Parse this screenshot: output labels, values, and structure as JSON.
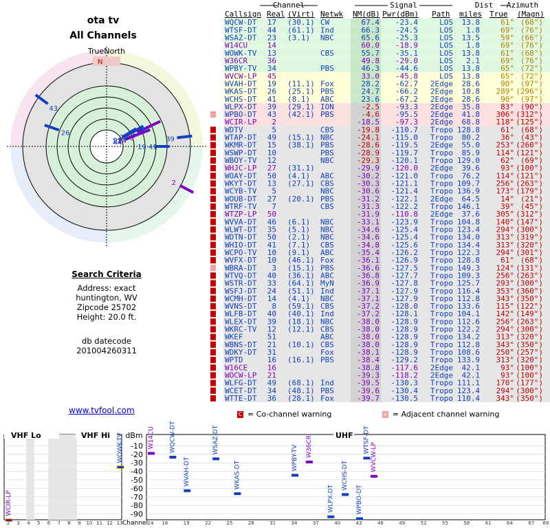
{
  "header": {
    "line1": "ota tv",
    "line2": "All Channels"
  },
  "polar": {
    "north_label": "TrueNorth",
    "n_label": "N"
  },
  "criteria": {
    "title": "Search Criteria",
    "lines": [
      "Address: exact",
      "huntington, WV",
      "Zipcode 25702",
      "Height: 20.0 ft."
    ],
    "db_lines": [
      "db datecode",
      "201004260311"
    ]
  },
  "link": "www.tvfool.com",
  "table_headers": {
    "group_channel": "Channel",
    "group_signal": "Signal",
    "group_dist": "Dist",
    "group_az": "Azimuth",
    "callsign": "Callsign",
    "real": "Real",
    "virt": "(Virt)",
    "netwk": "Netwk",
    "nm": "NM(dB)",
    "pwr": "Pwr(dBm)",
    "path": "Path",
    "miles": "miles",
    "true": "True",
    "magn": "(Magn)"
  },
  "colors": {
    "green": "#008000",
    "blue": "#1040c0",
    "purple": "#8000c0",
    "red": "#c00000",
    "bg_green": "#e0f8e0",
    "bg_yellow": "#ffffd8",
    "bg_red": "#fbe0e0",
    "bg_gray": "#e6e6e6",
    "bg_nm": "#d2d2d2"
  },
  "rows": [
    [
      "WQCW-DT",
      "17",
      "(30.1)",
      "CW",
      "67.4",
      "-23.4",
      "LOS",
      "13.8",
      "61°",
      "(68°)",
      "g",
      ""
    ],
    [
      "WTSF-DT",
      "44",
      "(61.1)",
      "Ind",
      "66.3",
      "-24.5",
      "LOS",
      "1.8",
      "69°",
      "(76°)",
      "g",
      ""
    ],
    [
      "WSAZ-DT",
      "23",
      "(3.1)",
      "NBC",
      "65.6",
      "-25.3",
      "LOS",
      "13.5",
      "59°",
      "(66°)",
      "g",
      ""
    ],
    [
      "W14CU",
      "14",
      "",
      "",
      "60.0",
      "-18.9",
      "LOS",
      "1.8",
      "69°",
      "(76°)",
      "g",
      ""
    ],
    [
      "WOWK-TV",
      "13",
      "",
      "CBS",
      "55.7",
      "-35.1",
      "LOS",
      "13.8",
      "61°",
      "(68°)",
      "g",
      ""
    ],
    [
      "W36CR",
      "36",
      "",
      "",
      "49.8",
      "-29.0",
      "LOS",
      "2.1",
      "69°",
      "(76°)",
      "g",
      ""
    ],
    [
      "WPBY-TV",
      "34",
      "",
      "PBS",
      "46.3",
      "-44.6",
      "LOS",
      "13.8",
      "65°",
      "(72°)",
      "g",
      ""
    ],
    [
      "WVCW-LP",
      "45",
      "",
      "",
      "33.0",
      "-45.8",
      "LOS",
      "13.8",
      "65°",
      "(72°)",
      "y",
      ""
    ],
    [
      "WVAH-DT",
      "19",
      "(11.1)",
      "Fox",
      "28.2",
      "-62.7",
      "2Edge",
      "28.6",
      "90°",
      "(97°)",
      "y",
      ""
    ],
    [
      "WKAS-DT",
      "26",
      "(25.1)",
      "PBS",
      "24.7",
      "-66.2",
      "2Edge",
      "10.8",
      "289°",
      "(296°)",
      "y",
      ""
    ],
    [
      "WCHS-DT",
      "41",
      "(8.1)",
      "ABC",
      "23.6",
      "-67.2",
      "2Edge",
      "28.6",
      "90°",
      "(97°)",
      "y",
      ""
    ],
    [
      "WLPX-DT",
      "39",
      "(29.1)",
      "ION",
      "-2.5",
      "-93.3",
      "2Edge",
      "35.8",
      "83°",
      "(90°)",
      "r",
      ""
    ],
    [
      "WPBO-DT",
      "43",
      "(42.1)",
      "PBS",
      "-4.6",
      "-95.5",
      "2Edge",
      "41.8",
      "306°",
      "(312°)",
      "r",
      "a"
    ],
    [
      "WCIR-LP",
      "2",
      "",
      "",
      "-18.5",
      "-97.3",
      "2Edge",
      "68.8",
      "118°",
      "(125°)",
      "r",
      ""
    ],
    [
      "WDTV",
      "5",
      "",
      "CBS",
      "-19.8",
      "-110.7",
      "Tropo",
      "128.8",
      "61°",
      "(68°)",
      "n",
      "c"
    ],
    [
      "WTAP-DT",
      "49",
      "(15.1)",
      "NBC",
      "-24.1",
      "-115.0",
      "Tropo",
      "80.2",
      "36°",
      "(43°)",
      "n",
      "c"
    ],
    [
      "WKMR-DT",
      "15",
      "(38.1)",
      "PBS",
      "-28.6",
      "-119.5",
      "2Edge",
      "55.0",
      "253°",
      "(260°)",
      "n",
      "c"
    ],
    [
      "WSWP-DT",
      "10",
      "",
      "PBS",
      "-28.9",
      "-119.7",
      "Tropo",
      "85.9",
      "114°",
      "(121°)",
      "n",
      "c"
    ],
    [
      "WBOY-TV",
      "12",
      "",
      "NBC",
      "-29.3",
      "-120.1",
      "Tropo",
      "129.0",
      "62°",
      "(69°)",
      "n",
      "c"
    ],
    [
      "WHJC-LP",
      "27",
      "(31.1)",
      "",
      "-29.9",
      "-120.0",
      "2Edge",
      "39.6",
      "93°",
      "(100°)",
      "n",
      "c"
    ],
    [
      "WOAY-DT",
      "50",
      "(4.1)",
      "ABC",
      "-30.2",
      "-121.0",
      "Tropo",
      "76.2",
      "114°",
      "(121°)",
      "n",
      "c"
    ],
    [
      "WKYT-DT",
      "13",
      "(27.1)",
      "CBS",
      "-30.3",
      "-121.1",
      "Tropo",
      "109.7",
      "256°",
      "(263°)",
      "n",
      "c"
    ],
    [
      "WCYB-TV",
      "5",
      "",
      "NBC",
      "-30.6",
      "-121.4",
      "Tropo",
      "136.9",
      "173°",
      "(179°)",
      "n",
      "c"
    ],
    [
      "WOUB-DT",
      "27",
      "(20.1)",
      "PBS",
      "-31.2",
      "-122.1",
      "2Edge",
      "64.5",
      "14°",
      "(21°)",
      "n",
      "c"
    ],
    [
      "WTRF-TV",
      "7",
      "",
      "CBS",
      "-31.3",
      "-122.2",
      "Tropo",
      "146.1",
      "39°",
      "(45°)",
      "n",
      "c"
    ],
    [
      "WTZP-LP",
      "50",
      "",
      "",
      "-31.9",
      "-110.8",
      "2Edge",
      "37.6",
      "305°",
      "(312°)",
      "p",
      "c"
    ],
    [
      "WVVA-DT",
      "46",
      "(6.1)",
      "NBC",
      "-33.1",
      "-123.9",
      "Tropo",
      "104.8",
      "140°",
      "(147°)",
      "n",
      "c"
    ],
    [
      "WLWT-DT",
      "35",
      "(5.1)",
      "NBC",
      "-34.6",
      "-125.4",
      "Tropo",
      "123.4",
      "294°",
      "(300°)",
      "n",
      "c"
    ],
    [
      "WDTN-DT",
      "50",
      "(2.1)",
      "NBC",
      "-34.6",
      "-125.4",
      "Tropo",
      "134.0",
      "313°",
      "(319°)",
      "n",
      "c"
    ],
    [
      "WHIO-DT",
      "41",
      "(7.1)",
      "CBS",
      "-34.8",
      "-125.6",
      "Tropo",
      "134.4",
      "313°",
      "(320°)",
      "n",
      "c"
    ],
    [
      "WCPO-TV",
      "10",
      "(9.1)",
      "ABC",
      "-35.4",
      "-126.2",
      "Tropo",
      "122.3",
      "294°",
      "(301°)",
      "n",
      "c"
    ],
    [
      "WVFX-DT",
      "10",
      "(46.1)",
      "Fox",
      "-36.1",
      "-126.9",
      "Tropo",
      "128.8",
      "61°",
      "(68°)",
      "n",
      "c"
    ],
    [
      "WBRA-DT",
      "3",
      "(15.1)",
      "PBS",
      "-36.6",
      "-127.5",
      "Tropo",
      "149.3",
      "124°",
      "(131°)",
      "n",
      "a"
    ],
    [
      "WTVQ-DT",
      "40",
      "(36.1)",
      "ABC",
      "-36.8",
      "-127.7",
      "Tropo",
      "109.3",
      "256°",
      "(263°)",
      "n",
      "c"
    ],
    [
      "WSTR-DT",
      "33",
      "(64.1)",
      "MyN",
      "-36.9",
      "-127.8",
      "Tropo",
      "125.7",
      "293°",
      "(300°)",
      "n",
      "c"
    ],
    [
      "WSFJ-DT",
      "24",
      "(51.1)",
      "Ind",
      "-37.1",
      "-127.9",
      "Tropo",
      "116.4",
      "353°",
      "(360°)",
      "n",
      "c"
    ],
    [
      "WCMH-DT",
      "14",
      "(4.1)",
      "NBC",
      "-37.1",
      "-127.9",
      "Tropo",
      "112.8",
      "343°",
      "(350°)",
      "n",
      "c"
    ],
    [
      "WVNS-DT",
      "8",
      "(59.1)",
      "CBS",
      "-37.2",
      "-128.0",
      "Tropo",
      "133.6",
      "115°",
      "(122°)",
      "n",
      "c"
    ],
    [
      "WLFB-DT",
      "40",
      "(40.1)",
      "Ind",
      "-37.2",
      "-128.1",
      "Tropo",
      "104.1",
      "142°",
      "(149°)",
      "n",
      "c"
    ],
    [
      "WLEX-DT",
      "39",
      "(18.1)",
      "NBC",
      "-38.0",
      "-128.9",
      "Tropo",
      "112.6",
      "256°",
      "(263°)",
      "n",
      "c"
    ],
    [
      "WKRC-TV",
      "12",
      "(12.1)",
      "CBS",
      "-38.0",
      "-128.9",
      "Tropo",
      "122.2",
      "294°",
      "(300°)",
      "n",
      "c"
    ],
    [
      "WKEF",
      "51",
      "",
      "ABC",
      "-38.0",
      "-128.9",
      "Tropo",
      "134.2",
      "313°",
      "(320°)",
      "n",
      "c"
    ],
    [
      "WBNS-DT",
      "21",
      "(10.1)",
      "CBS",
      "-38.0",
      "-128.9",
      "Tropo",
      "112.8",
      "343°",
      "(350°)",
      "n",
      "c"
    ],
    [
      "WDKY-DT",
      "31",
      "",
      "Fox",
      "-38.1",
      "-128.9",
      "Tropo",
      "108.6",
      "250°",
      "(257°)",
      "n",
      "c"
    ],
    [
      "WPTD",
      "16",
      "(16.1)",
      "PBS",
      "-38.4",
      "-129.2",
      "Tropo",
      "133.9",
      "313°",
      "(320°)",
      "n",
      "c"
    ],
    [
      "W16CE",
      "16",
      "",
      "",
      "-38.8",
      "-117.6",
      "2Edge",
      "42.1",
      "93°",
      "(100°)",
      "p",
      "c"
    ],
    [
      "WOCW-LP",
      "21",
      "",
      "",
      "-39.3",
      "-118.2",
      "2Edge",
      "42.1",
      "93°",
      "(100°)",
      "p",
      "c"
    ],
    [
      "WLFG-DT",
      "49",
      "(68.1)",
      "Ind",
      "-39.5",
      "-130.3",
      "Tropo",
      "111.1",
      "170°",
      "(177°)",
      "n",
      "c"
    ],
    [
      "WCET-DT",
      "34",
      "(48.1)",
      "PBS",
      "-39.6",
      "-130.4",
      "Tropo",
      "123.4",
      "294°",
      "(300°)",
      "n",
      "c"
    ],
    [
      "WTTE-DT",
      "36",
      "(28.1)",
      "Fox",
      "-39.7",
      "-130.5",
      "Tropo",
      "110.4",
      "343°",
      "(350°)",
      "n",
      "c"
    ]
  ],
  "warnings": {
    "co_box": "C",
    "co_label": "= Co-channel warning",
    "adj_box": "a",
    "adj_label": "= Adjacent channel warning"
  },
  "spectrum": {
    "vhf_lo": "VHF Lo",
    "vhf_hi": "VHF Hi",
    "uhf": "UHF",
    "dbm": "dBm",
    "axis_label": "Channel",
    "ylabels": [
      "-10",
      "-20",
      "-30",
      "-40",
      "-50",
      "-60",
      "-70",
      "-80",
      "-90"
    ],
    "vhf_ticks": [
      "2",
      "3",
      "4",
      "5",
      "6",
      "7",
      "8",
      "9",
      "10",
      "11",
      "12",
      "13"
    ],
    "uhf_ticks": [
      "14",
      "16",
      "19",
      "22",
      "25",
      "28",
      "31",
      "34",
      "37",
      "40",
      "43",
      "46",
      "49",
      "52",
      "55",
      "58",
      "61",
      "64",
      "67",
      "69"
    ],
    "stations": [
      {
        "name": "WCIR-LP",
        "ch": 2,
        "dbm": -97.3,
        "color": "#8000c0",
        "band": "vhf"
      },
      {
        "name": "WOWK-TV",
        "ch": 13,
        "dbm": -35.1,
        "color": "#1040c0",
        "band": "vhf"
      },
      {
        "name": "W14CU",
        "ch": 14,
        "dbm": -18.9,
        "color": "#8000c0",
        "band": "uhf"
      },
      {
        "name": "WQCW-DT",
        "ch": 17,
        "dbm": -23.4,
        "color": "#1040c0",
        "band": "uhf"
      },
      {
        "name": "WVAH-DT",
        "ch": 19,
        "dbm": -62.7,
        "color": "#1040c0",
        "band": "uhf"
      },
      {
        "name": "WSAZ-DT",
        "ch": 23,
        "dbm": -25.3,
        "color": "#1040c0",
        "band": "uhf"
      },
      {
        "name": "WKAS-DT",
        "ch": 26,
        "dbm": -66.2,
        "color": "#1040c0",
        "band": "uhf"
      },
      {
        "name": "WPBY-TV",
        "ch": 34,
        "dbm": -44.6,
        "color": "#1040c0",
        "band": "uhf"
      },
      {
        "name": "W36CR",
        "ch": 36,
        "dbm": -29.0,
        "color": "#8000c0",
        "band": "uhf"
      },
      {
        "name": "WLPX-DT",
        "ch": 39,
        "dbm": -93.3,
        "color": "#1040c0",
        "band": "uhf"
      },
      {
        "name": "WCHS-DT",
        "ch": 41,
        "dbm": -67.2,
        "color": "#1040c0",
        "band": "uhf"
      },
      {
        "name": "WPBO-DT",
        "ch": 43,
        "dbm": -95.5,
        "color": "#1040c0",
        "band": "uhf"
      },
      {
        "name": "WTSF-DT",
        "ch": 44,
        "dbm": -24.5,
        "color": "#1040c0",
        "band": "uhf"
      },
      {
        "name": "WVCW-LP",
        "ch": 45,
        "dbm": -45.8,
        "color": "#8000c0",
        "band": "uhf"
      }
    ]
  },
  "polar_stations": [
    {
      "label": "43",
      "az": 306,
      "nm": -4.6,
      "color": "#1040c0"
    },
    {
      "label": "26",
      "az": 289,
      "nm": 24.7,
      "color": "#1040c0"
    },
    {
      "label": "39",
      "az": 83,
      "nm": -2.5,
      "color": "#1040c0"
    },
    {
      "label": "19 41",
      "az": 90,
      "nm": 28.2,
      "color": "#1040c0"
    },
    {
      "label": "2",
      "az": 118,
      "nm": -18.5,
      "color": "#8000c0"
    },
    {
      "label": "17",
      "az": 61,
      "nm": 67.4,
      "color": "#1040c0"
    },
    {
      "label": "23",
      "az": 59,
      "nm": 65.6,
      "color": "#1040c0"
    },
    {
      "label": "13",
      "az": 61,
      "nm": 55.7,
      "color": "#1040c0"
    },
    {
      "label": "34",
      "az": 65,
      "nm": 46.3,
      "color": "#1040c0"
    },
    {
      "label": "44",
      "az": 69,
      "nm": 66.3,
      "color": "#1040c0"
    },
    {
      "label": "14",
      "az": 69,
      "nm": 60.0,
      "color": "#8000c0"
    },
    {
      "label": "36",
      "az": 69,
      "nm": 49.8,
      "color": "#8000c0"
    },
    {
      "label": "45",
      "az": 65,
      "nm": 33.0,
      "color": "#8000c0"
    }
  ]
}
